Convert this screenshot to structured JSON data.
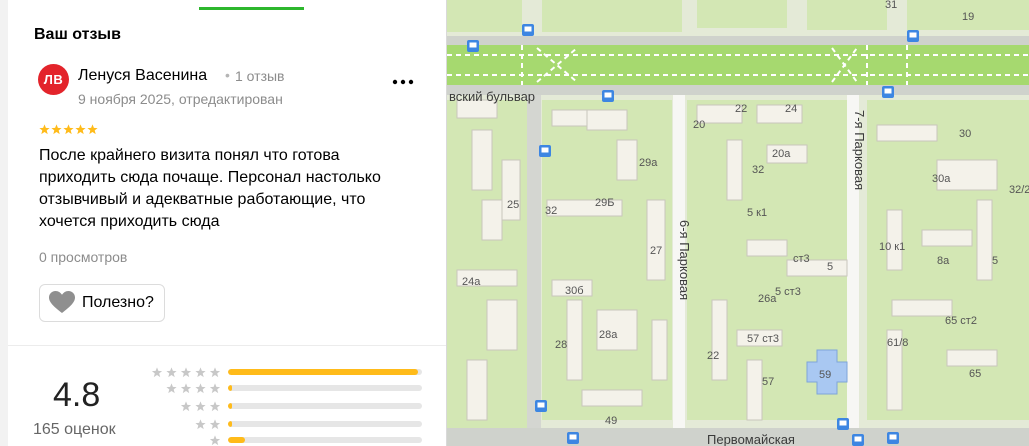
{
  "panel": {
    "header_title": "Ваш отзыв"
  },
  "review": {
    "avatar_initials": "ЛВ",
    "author_name": "Ленуся Васенина",
    "dot_separator": "•",
    "review_count": "1 отзыв",
    "date": "9 ноября 2025, отредактирован",
    "rating": 5,
    "text": "После крайнего визита понял что готова приходить сюда почаще. Персонал настолько отзывчивый и адекватные работающие, что хочется приходить сюда",
    "views": "0 просмотров",
    "helpful_label": "Полезно?"
  },
  "rating_summary": {
    "value": "4.8",
    "count": "165 оценок",
    "distribution": [
      {
        "stars": 5,
        "fraction": 0.98
      },
      {
        "stars": 4,
        "fraction": 0.02
      },
      {
        "stars": 3,
        "fraction": 0.02
      },
      {
        "stars": 2,
        "fraction": 0.02
      },
      {
        "stars": 1,
        "fraction": 0.09
      }
    ]
  },
  "colors": {
    "accent_green": "#2db72d",
    "avatar_red": "#e3242b",
    "star_yellow": "#ffbb1a",
    "star_gray": "#d6d6d6"
  },
  "map": {
    "streets": {
      "boulevard": "вский бульвар",
      "park6": "6-я Парковая",
      "park7": "7-я Парковая",
      "pervomayskaya": "Первомайская"
    },
    "house_numbers": [
      "31",
      "19",
      "22",
      "24",
      "30",
      "20",
      "20а",
      "29а",
      "30а",
      "32",
      "32/2",
      "5 к1",
      "ст3",
      "25",
      "32",
      "29Б",
      "27",
      "10 к1",
      "8а",
      "5",
      "24а",
      "5 ст3",
      "5",
      "30б",
      "26а",
      "28а",
      "65 ст2",
      "61/8",
      "28",
      "22",
      "57 ст3",
      "59",
      "57",
      "65",
      "49"
    ]
  }
}
